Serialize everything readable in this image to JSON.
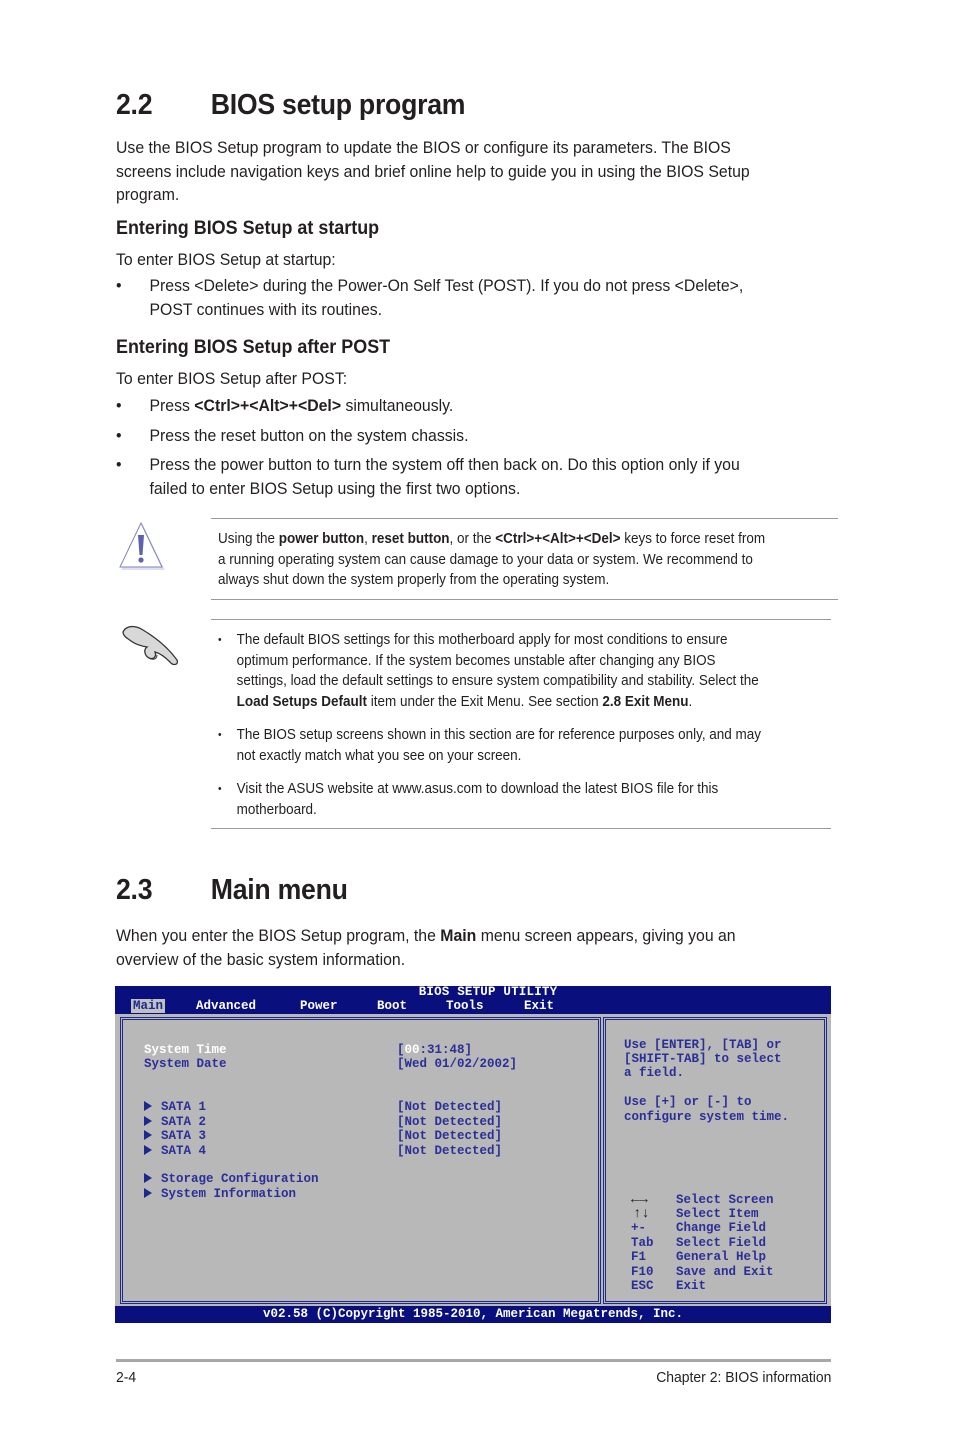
{
  "section_22": {
    "number": "2.2",
    "title": "BIOS setup program",
    "intro": [
      "Use the BIOS Setup program to update the BIOS or configure its parameters. The BIOS",
      "screens include navigation keys and brief online help to guide you in using the BIOS Setup",
      "program."
    ],
    "startup": {
      "heading": "Entering BIOS Setup at startup",
      "lead": "To enter BIOS Setup at startup:",
      "bullets": [
        [
          "Press <Delete> during the Power-On Self Test (POST). If you do not press <Delete>,",
          "POST continues with its routines."
        ]
      ]
    },
    "after_post": {
      "heading": "Entering BIOS Setup after POST",
      "lead": "To enter BIOS Setup after POST:",
      "bullet1": {
        "pre": "Press ",
        "bold": "<Ctrl>+<Alt>+<Del>",
        "post": " simultaneously."
      },
      "bullet2": "Press the reset button on the system chassis.",
      "bullet3": [
        "Press the power button to turn the system off then back on. Do this option only if you",
        "failed to enter BIOS Setup using the first two options."
      ]
    },
    "bullet_char": "•"
  },
  "warning": {
    "icon": "warning-triangle-icon",
    "line1": {
      "a": "Using the ",
      "b1": "power button",
      "c": ", ",
      "b2": "reset button",
      "d": ", or the ",
      "b3": "<Ctrl>+<Alt>+<Del>",
      "e": " keys to force reset from"
    },
    "line2": "a running operating system can cause damage to your data or system. We recommend to",
    "line3": "always shut down the system properly from the operating system."
  },
  "note": {
    "icon": "pointing-hand-icon",
    "bullets": [
      {
        "lines": [
          "The default BIOS settings for this motherboard apply for most conditions to ensure",
          "optimum performance. If the system becomes unstable after changing any BIOS",
          "settings, load the default settings to ensure system compatibility and stability. Select the"
        ],
        "last": {
          "b1": "Load Setups Default",
          "mid": " item under the Exit Menu. See section ",
          "b2": "2.8 Exit Menu",
          "end": "."
        }
      },
      {
        "lines": [
          "The BIOS setup screens shown in this section are for reference purposes only, and may",
          "not exactly match what you see on your screen."
        ]
      },
      {
        "lines": [
          "Visit the ASUS website at www.asus.com to download the latest BIOS file for this",
          "motherboard."
        ]
      }
    ]
  },
  "section_23": {
    "number": "2.3",
    "title": "Main menu",
    "intro_pre": "When you enter the BIOS Setup program, the ",
    "intro_bold": "Main",
    "intro_post": " menu screen appears, giving you an",
    "intro_line2": "overview of the basic system information."
  },
  "bios": {
    "title": "BIOS SETUP UTILITY",
    "menu": [
      "Main",
      "Advanced",
      "Power",
      "Boot",
      "Tools",
      "Exit"
    ],
    "active_menu": "Main",
    "fields": [
      {
        "label": "System Time",
        "value_prefix": "[",
        "value_highlight": "00",
        "value_rest": ":31:48]"
      },
      {
        "label": "System Date",
        "value": "[Wed 01/02/2002]"
      }
    ],
    "sata": [
      {
        "label": "SATA 1",
        "value": "[Not Detected]"
      },
      {
        "label": "SATA 2",
        "value": "[Not Detected]"
      },
      {
        "label": "SATA 3",
        "value": "[Not Detected]"
      },
      {
        "label": "SATA 4",
        "value": "[Not Detected]"
      }
    ],
    "submenus": [
      "Storage Configuration",
      "System Information"
    ],
    "help": [
      "Use [ENTER], [TAB] or",
      "[SHIFT-TAB] to select",
      "a field.",
      "",
      "Use [+] or [-] to",
      "configure system time."
    ],
    "keys": [
      {
        "key": "←→",
        "desc": "Select Screen"
      },
      {
        "key": "↑↓",
        "desc": "Select Item"
      },
      {
        "key": "+-",
        "desc": "Change Field"
      },
      {
        "key": "Tab",
        "desc": "Select Field"
      },
      {
        "key": "F1",
        "desc": "General Help"
      },
      {
        "key": "F10",
        "desc": "Save and Exit"
      },
      {
        "key": "ESC",
        "desc": "Exit"
      }
    ],
    "footer": "v02.58 (C)Copyright 1985-2010, American Megatrends, Inc.",
    "colors": {
      "bar": "#0a0f7e",
      "panel": "#b8b8b8",
      "text": "#2a2f98"
    }
  },
  "footer": {
    "page": "2-4",
    "chapter": "Chapter 2: BIOS information"
  }
}
